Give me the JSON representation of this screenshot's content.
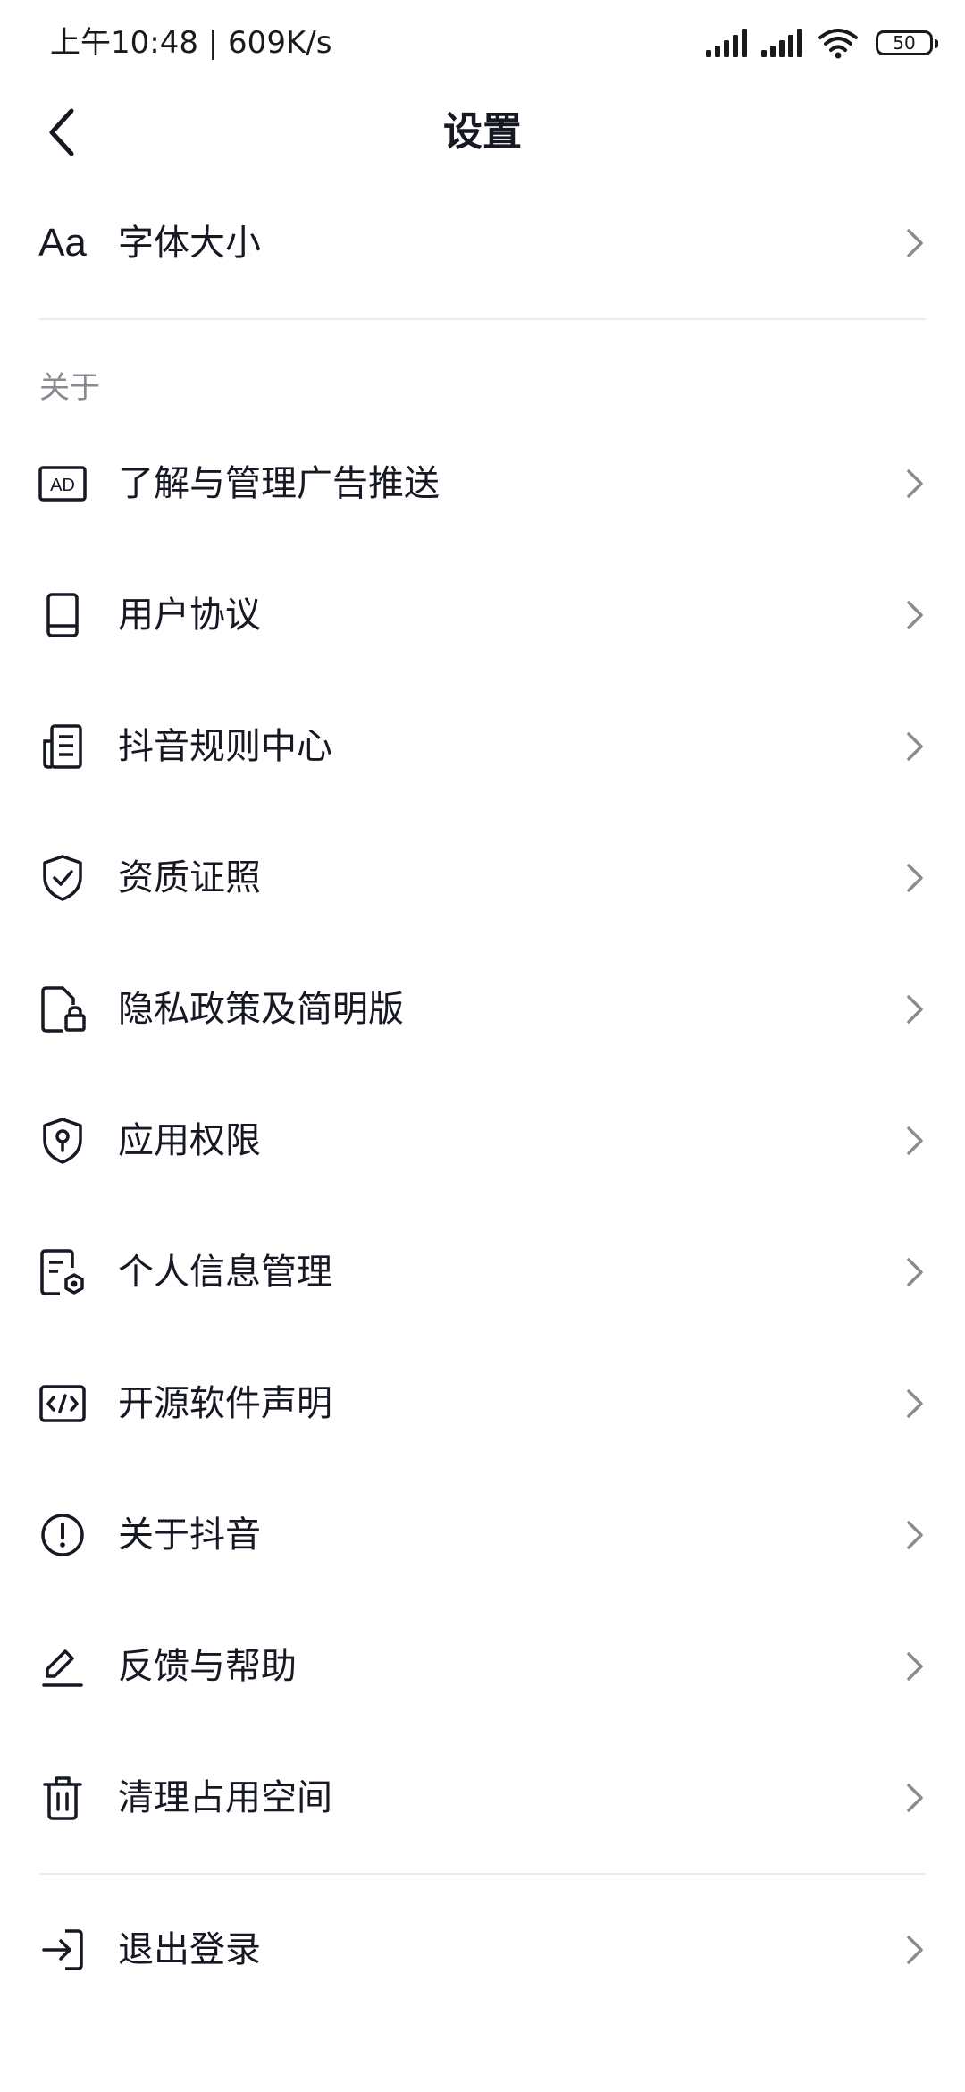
{
  "status_bar": {
    "time": "上午10:48 | 609K/s",
    "battery": "50"
  },
  "header": {
    "title": "设置"
  },
  "rows": [
    {
      "label": "字体大小"
    },
    {
      "label": "了解与管理广告推送"
    },
    {
      "label": "用户协议"
    },
    {
      "label": "抖音规则中心"
    },
    {
      "label": "资质证照"
    },
    {
      "label": "隐私政策及简明版"
    },
    {
      "label": "应用权限"
    },
    {
      "label": "个人信息管理"
    },
    {
      "label": "开源软件声明"
    },
    {
      "label": "关于抖音"
    },
    {
      "label": "反馈与帮助"
    },
    {
      "label": "清理占用空间"
    },
    {
      "label": "退出登录"
    }
  ],
  "font_icon_text": "Aa",
  "ad_icon_text": "AD",
  "section": {
    "about_label": "关于"
  },
  "colors": {
    "text_primary": "#161823",
    "text_secondary": "#8a8b91",
    "chevron": "#8a8b91",
    "divider": "#ececec"
  }
}
